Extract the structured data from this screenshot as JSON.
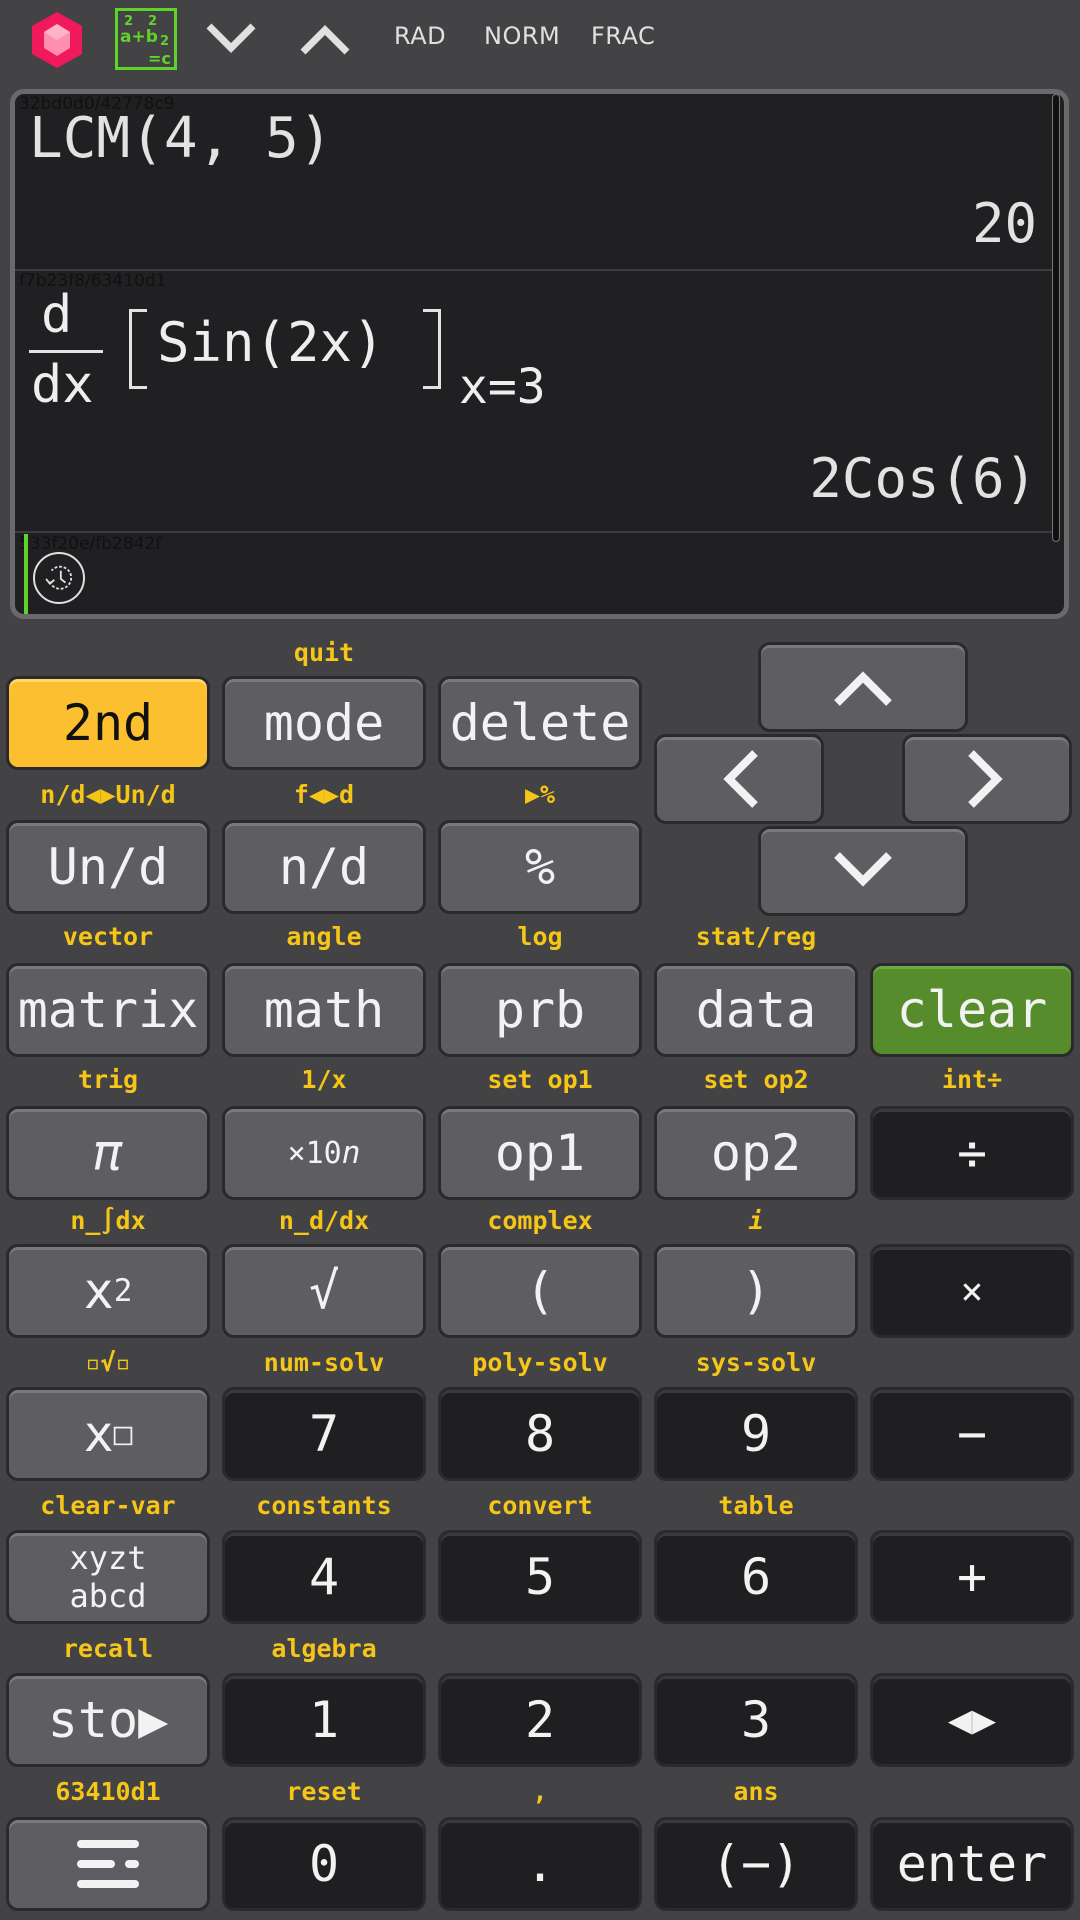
{
  "header": {
    "app_icon": "gem-icon",
    "formula_icon": "formula-icon",
    "scroll_down_icon": "chevron-down-icon",
    "scroll_up_icon": "chevron-up-icon",
    "indicators": [
      "RAD",
      "NORM",
      "FRAC"
    ]
  },
  "display": {
    "entries": [
      {
        "id": "32bd0d0/42778c9",
        "expression": "LCM(4, 5)",
        "result": "20"
      },
      {
        "id": "f7b23f8/63410d1",
        "expression_parts": {
          "num": "d",
          "den": "dx",
          "body": "Sin(2x)",
          "eval": "x=3"
        },
        "result": "2Cos(6)"
      },
      {
        "id": "533f20e/fb2842f",
        "expression": "",
        "result": ""
      }
    ],
    "history_icon": "history-icon"
  },
  "colors": {
    "background": "#434245",
    "display": "#201f22",
    "second_key": "#fbbf30",
    "clear_key": "#568c2c",
    "secondary_label": "#f5c518",
    "cursor": "#5fd32a"
  },
  "keys": {
    "row1": [
      {
        "sub": "",
        "label": "2nd"
      },
      {
        "sub": "quit",
        "label": "mode"
      },
      {
        "sub": "",
        "label": "delete"
      }
    ],
    "row2": [
      {
        "sub": "n/d◀▶Un/d",
        "label": "Un/d"
      },
      {
        "sub": "f◀▶d",
        "label": "n/d"
      },
      {
        "sub": "▶%",
        "label": "%"
      }
    ],
    "nav": {
      "up": "up-arrow",
      "left": "left-arrow",
      "right": "right-arrow",
      "down": "down-arrow"
    },
    "row3": [
      {
        "sub": "vector",
        "label": "matrix"
      },
      {
        "sub": "angle",
        "label": "math"
      },
      {
        "sub": "log",
        "label": "prb"
      },
      {
        "sub": "stat/reg",
        "label": "data"
      },
      {
        "sub": "",
        "label": "clear"
      }
    ],
    "row4": [
      {
        "sub": "trig",
        "label": "π"
      },
      {
        "sub": "1/x",
        "label": "×10",
        "sup": "n"
      },
      {
        "sub": "set op1",
        "label": "op1"
      },
      {
        "sub": "set op2",
        "label": "op2"
      },
      {
        "sub": "int÷",
        "label": "÷"
      }
    ],
    "row5": [
      {
        "sub": "n_∫dx",
        "label": "x",
        "sup": "2"
      },
      {
        "sub": "n_d/dx",
        "label": "√"
      },
      {
        "sub": "complex",
        "label": "("
      },
      {
        "sub": "i",
        "label": ")"
      },
      {
        "sub": "",
        "label": "×"
      }
    ],
    "row6": [
      {
        "sub": "▫√▫",
        "label": "x",
        "sup": "□"
      },
      {
        "sub": "num-solv",
        "label": "7"
      },
      {
        "sub": "poly-solv",
        "label": "8"
      },
      {
        "sub": "sys-solv",
        "label": "9"
      },
      {
        "sub": "",
        "label": "−"
      }
    ],
    "row7": [
      {
        "sub": "clear-var",
        "label_line1": "xyzt",
        "label_line2": "abcd"
      },
      {
        "sub": "constants",
        "label": "4"
      },
      {
        "sub": "convert",
        "label": "5"
      },
      {
        "sub": "table",
        "label": "6"
      },
      {
        "sub": "",
        "label": "+"
      }
    ],
    "row8": [
      {
        "sub": "recall",
        "label": "sto▶"
      },
      {
        "sub": "algebra",
        "label": "1"
      },
      {
        "sub": "",
        "label": "2"
      },
      {
        "sub": "",
        "label": "3"
      },
      {
        "sub": "",
        "label": "◀▶"
      }
    ],
    "row9": [
      {
        "sub": "63410d1",
        "label": "menu-icon"
      },
      {
        "sub": "reset",
        "label": "0"
      },
      {
        "sub": ",",
        "label": "."
      },
      {
        "sub": "ans",
        "label": "(−)"
      },
      {
        "sub": "",
        "label": "enter"
      }
    ]
  }
}
